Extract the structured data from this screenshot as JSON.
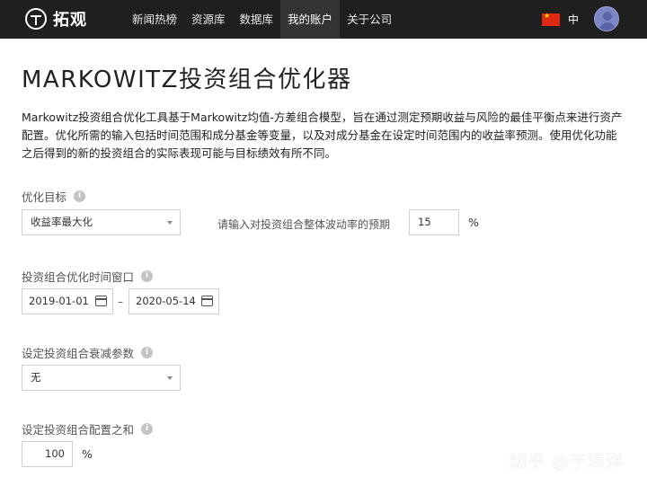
{
  "header": {
    "logo_text": "拓观",
    "nav": [
      "新闻热榜",
      "资源库",
      "数据库",
      "我的账户",
      "关于公司"
    ],
    "active_nav_index": 3,
    "language": "中",
    "flag_icon": "china-flag-icon",
    "avatar_icon": "user-avatar-icon"
  },
  "main": {
    "title": "MARKOWITZ投资组合优化器",
    "description": "Markowitz投资组合优化工具基于Markowitz均值-方差组合模型，旨在通过测定预期收益与风险的最佳平衡点来进行资产配置。优化所需的输入包括时间范围和成分基金等变量，以及对成分基金在设定时间范围内的收益率预测。使用优化功能之后得到的新的投资组合的实际表现可能与目标绩效有所不同。"
  },
  "form": {
    "objective": {
      "label": "优化目标",
      "selected": "收益率最大化",
      "vol_hint": "请输入对投资组合整体波动率的预期",
      "vol_value": "15",
      "vol_unit": "%"
    },
    "window": {
      "label": "投资组合优化时间窗口",
      "start": "2019-01-01",
      "separator": "–",
      "end": "2020-05-14"
    },
    "decay": {
      "label": "设定投资组合衰减参数",
      "selected": "无"
    },
    "allocation": {
      "label": "设定投资组合配置之和",
      "value": "100",
      "unit": "%"
    }
  },
  "watermark": "知乎 @于泽洋",
  "colors": {
    "topbar": "#1f1f1f",
    "active_tab": "#333333",
    "border": "#d0d0d0",
    "info_icon": "#c4c4c4"
  }
}
